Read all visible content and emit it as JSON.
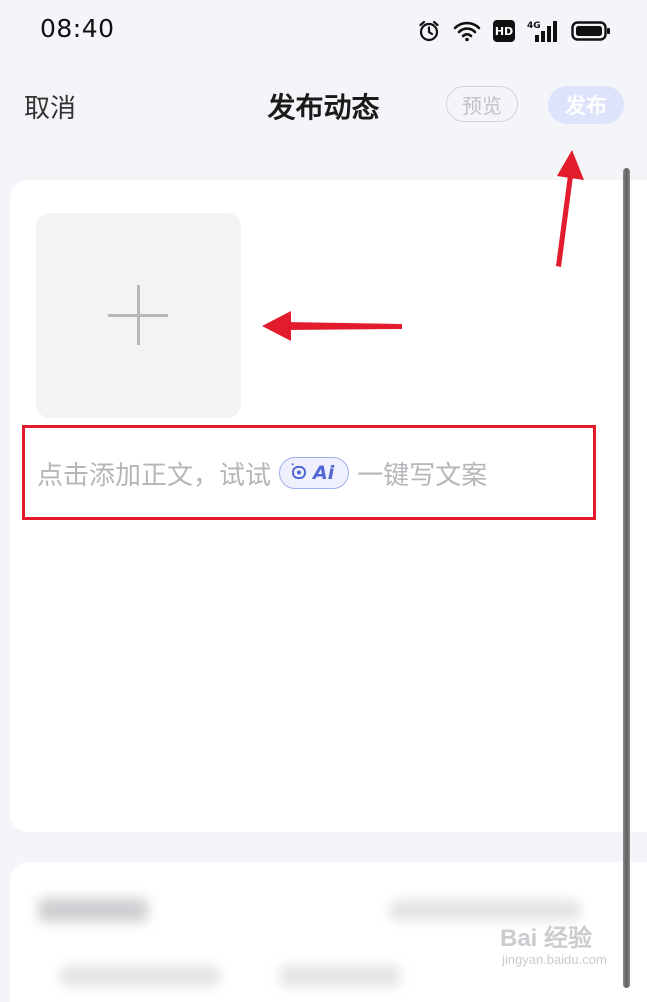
{
  "status_bar": {
    "time": "08:40",
    "icons": [
      "alarm-icon",
      "wifi-icon",
      "hd-icon",
      "cellular-4g-icon",
      "battery-icon"
    ],
    "hd_label": "HD",
    "network_label": "4G"
  },
  "header": {
    "cancel_label": "取消",
    "title": "发布动态",
    "preview_label": "预览",
    "publish_label": "发布"
  },
  "editor": {
    "add_media_icon": "plus-icon",
    "placeholder_before": "点击添加正文，试试",
    "ai_badge_label": "Ai",
    "placeholder_after": "一键写文案"
  },
  "watermark": {
    "main": "Bai 经验",
    "sub": "jingyan.baidu.com"
  },
  "colors": {
    "background": "#f4f5f9",
    "card": "#ffffff",
    "publish_button": "#dce3fb",
    "ai_accent": "#5468d4",
    "annotation_red": "#e21b2d",
    "placeholder_text": "#b5b5ba"
  }
}
